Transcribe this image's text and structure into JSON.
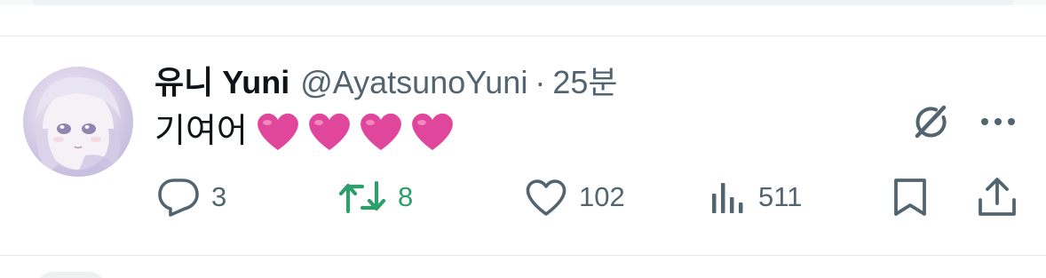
{
  "tweet": {
    "display_name": "유니 Yuni",
    "handle": "@AyatsunoYuni",
    "separator": "·",
    "time": "25분",
    "text": "기여어",
    "hearts": [
      "pink-heart-emoji",
      "pink-heart-emoji",
      "pink-heart-emoji",
      "pink-heart-emoji"
    ],
    "actions": {
      "reply": {
        "icon": "reply-icon",
        "count": "3"
      },
      "retweet": {
        "icon": "retweet-icon",
        "count": "8"
      },
      "like": {
        "icon": "heart-icon",
        "count": "102"
      },
      "views": {
        "icon": "views-chart-icon",
        "count": "511"
      },
      "bookmark": {
        "icon": "bookmark-icon"
      },
      "share": {
        "icon": "share-icon"
      }
    }
  },
  "colors": {
    "text_primary": "#0f1419",
    "text_secondary": "#536471",
    "retweet_active": "#2f9e6d",
    "heart_emoji": "#e0469b",
    "divider": "#e6e9ec"
  }
}
